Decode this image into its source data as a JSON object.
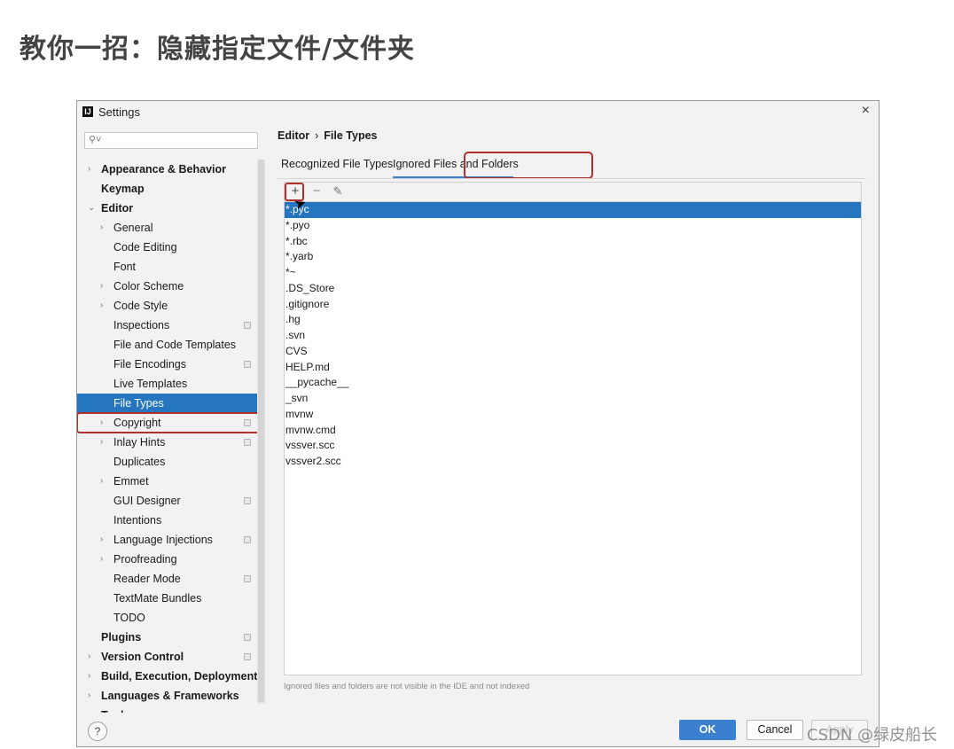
{
  "banner": {
    "title": "教你一招：隐藏指定文件/文件夹"
  },
  "window": {
    "title": "Settings",
    "close_glyph": "×",
    "app_icon_letter": "IJ"
  },
  "search": {
    "placeholder": "",
    "icon": "search-icon"
  },
  "tree": [
    {
      "label": "Appearance & Behavior",
      "level": 0,
      "bold": true,
      "chevron": "right",
      "gear": false
    },
    {
      "label": "Keymap",
      "level": 0,
      "bold": true,
      "chevron": "none",
      "gear": false
    },
    {
      "label": "Editor",
      "level": 0,
      "bold": true,
      "chevron": "down",
      "gear": false
    },
    {
      "label": "General",
      "level": 1,
      "bold": false,
      "chevron": "right",
      "gear": false
    },
    {
      "label": "Code Editing",
      "level": 1,
      "bold": false,
      "chevron": "none",
      "gear": false
    },
    {
      "label": "Font",
      "level": 1,
      "bold": false,
      "chevron": "none",
      "gear": false
    },
    {
      "label": "Color Scheme",
      "level": 1,
      "bold": false,
      "chevron": "right",
      "gear": false
    },
    {
      "label": "Code Style",
      "level": 1,
      "bold": false,
      "chevron": "right",
      "gear": false
    },
    {
      "label": "Inspections",
      "level": 1,
      "bold": false,
      "chevron": "none",
      "gear": true
    },
    {
      "label": "File and Code Templates",
      "level": 1,
      "bold": false,
      "chevron": "none",
      "gear": false
    },
    {
      "label": "File Encodings",
      "level": 1,
      "bold": false,
      "chevron": "none",
      "gear": true
    },
    {
      "label": "Live Templates",
      "level": 1,
      "bold": false,
      "chevron": "none",
      "gear": false
    },
    {
      "label": "File Types",
      "level": 1,
      "bold": false,
      "chevron": "none",
      "gear": false,
      "selected": true
    },
    {
      "label": "Copyright",
      "level": 1,
      "bold": false,
      "chevron": "right",
      "gear": true
    },
    {
      "label": "Inlay Hints",
      "level": 1,
      "bold": false,
      "chevron": "right",
      "gear": true
    },
    {
      "label": "Duplicates",
      "level": 1,
      "bold": false,
      "chevron": "none",
      "gear": false
    },
    {
      "label": "Emmet",
      "level": 1,
      "bold": false,
      "chevron": "right",
      "gear": false
    },
    {
      "label": "GUI Designer",
      "level": 1,
      "bold": false,
      "chevron": "none",
      "gear": true
    },
    {
      "label": "Intentions",
      "level": 1,
      "bold": false,
      "chevron": "none",
      "gear": false
    },
    {
      "label": "Language Injections",
      "level": 1,
      "bold": false,
      "chevron": "right",
      "gear": true
    },
    {
      "label": "Proofreading",
      "level": 1,
      "bold": false,
      "chevron": "right",
      "gear": false
    },
    {
      "label": "Reader Mode",
      "level": 1,
      "bold": false,
      "chevron": "none",
      "gear": true
    },
    {
      "label": "TextMate Bundles",
      "level": 1,
      "bold": false,
      "chevron": "none",
      "gear": false
    },
    {
      "label": "TODO",
      "level": 1,
      "bold": false,
      "chevron": "none",
      "gear": false
    },
    {
      "label": "Plugins",
      "level": 0,
      "bold": true,
      "chevron": "none",
      "gear": true
    },
    {
      "label": "Version Control",
      "level": 0,
      "bold": true,
      "chevron": "right",
      "gear": true
    },
    {
      "label": "Build, Execution, Deployment",
      "level": 0,
      "bold": true,
      "chevron": "right",
      "gear": false
    },
    {
      "label": "Languages & Frameworks",
      "level": 0,
      "bold": true,
      "chevron": "right",
      "gear": false
    },
    {
      "label": "Tools",
      "level": 0,
      "bold": true,
      "chevron": "right",
      "gear": false
    }
  ],
  "breadcrumb": {
    "parent": "Editor",
    "separator": "›",
    "current": "File Types"
  },
  "tabs": {
    "recognized": "Recognized File Types",
    "ignored": "Ignored Files and Folders",
    "active": "ignored"
  },
  "toolbar": {
    "add": "+",
    "remove": "−",
    "edit": "✎"
  },
  "ignored_items": [
    "*.pyc",
    "*.pyo",
    "*.rbc",
    "*.yarb",
    "*~",
    ".DS_Store",
    ".gitignore",
    ".hg",
    ".svn",
    "CVS",
    "HELP.md",
    "__pycache__",
    "_svn",
    "mvnw",
    "mvnw.cmd",
    "vssver.scc",
    "vssver2.scc"
  ],
  "selected_item": 0,
  "hint": "Ignored files and folders are not visible in the IDE and not indexed",
  "buttons": {
    "help": "?",
    "ok": "OK",
    "cancel": "Cancel",
    "apply": "Apply"
  },
  "watermark": "CSDN @绿皮船长",
  "colors": {
    "selection": "#2675bf",
    "highlight_outline": "#b0302d",
    "ok_button": "#3b80cf",
    "tab_underline": "#3f7fd0"
  }
}
